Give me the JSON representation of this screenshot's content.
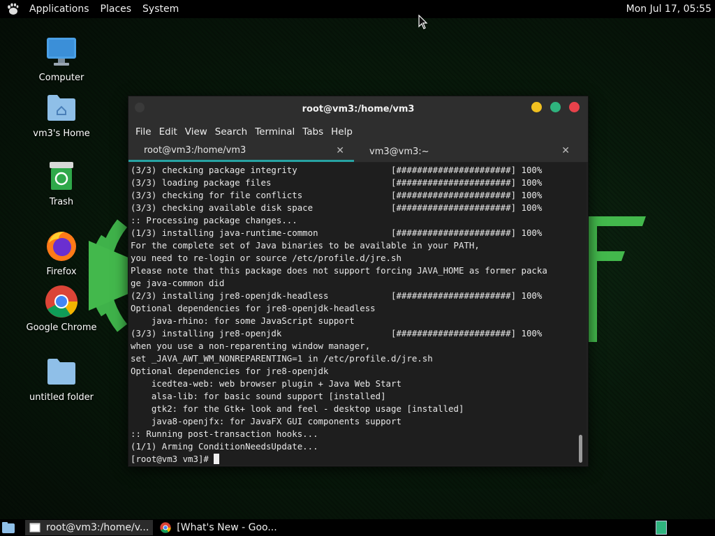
{
  "top_panel": {
    "menus": [
      "Applications",
      "Places",
      "System"
    ],
    "clock": "Mon Jul 17, 05:55"
  },
  "desktop_icons": [
    {
      "label": "Computer",
      "icon": "computer-icon"
    },
    {
      "label": "vm3's Home",
      "icon": "home-folder-icon"
    },
    {
      "label": "Trash",
      "icon": "trash-icon"
    },
    {
      "label": "Firefox",
      "icon": "firefox-icon"
    },
    {
      "label": "Google Chrome",
      "icon": "chrome-icon"
    },
    {
      "label": "untitled folder",
      "icon": "folder-icon"
    }
  ],
  "terminal": {
    "title": "root@vm3:/home/vm3",
    "menu": [
      "File",
      "Edit",
      "View",
      "Search",
      "Terminal",
      "Tabs",
      "Help"
    ],
    "tabs": [
      {
        "label": "root@vm3:/home/vm3",
        "active": true
      },
      {
        "label": "vm3@vm3:~",
        "active": false
      }
    ],
    "lines": [
      "(3/3) checking package integrity                  [######################] 100%",
      "(3/3) loading package files                       [######################] 100%",
      "(3/3) checking for file conflicts                 [######################] 100%",
      "(3/3) checking available disk space               [######################] 100%",
      ":: Processing package changes...",
      "(1/3) installing java-runtime-common              [######################] 100%",
      "For the complete set of Java binaries to be available in your PATH,",
      "you need to re-login or source /etc/profile.d/jre.sh",
      "Please note that this package does not support forcing JAVA_HOME as former packa",
      "ge java-common did",
      "(2/3) installing jre8-openjdk-headless            [######################] 100%",
      "Optional dependencies for jre8-openjdk-headless",
      "    java-rhino: for some JavaScript support",
      "(3/3) installing jre8-openjdk                     [######################] 100%",
      "when you use a non-reparenting window manager,",
      "set _JAVA_AWT_WM_NONREPARENTING=1 in /etc/profile.d/jre.sh",
      "Optional dependencies for jre8-openjdk",
      "    icedtea-web: web browser plugin + Java Web Start",
      "    alsa-lib: for basic sound support [installed]",
      "    gtk2: for the Gtk+ look and feel - desktop usage [installed]",
      "    java8-openjfx: for JavaFX GUI components support",
      ":: Running post-transaction hooks...",
      "(1/1) Arming ConditionNeedsUpdate..."
    ],
    "prompt": "[root@vm3 vm3]# "
  },
  "taskbar": {
    "items": [
      {
        "label": "root@vm3:/home/v...",
        "icon": "terminal-icon",
        "active": true
      },
      {
        "label": "[What's New - Goo...",
        "icon": "chrome-icon",
        "active": false
      }
    ]
  },
  "colors": {
    "tab_underline": "#27a3a3",
    "btn_min": "#f0c020",
    "btn_max": "#2fb37e",
    "btn_close": "#e8424b"
  }
}
